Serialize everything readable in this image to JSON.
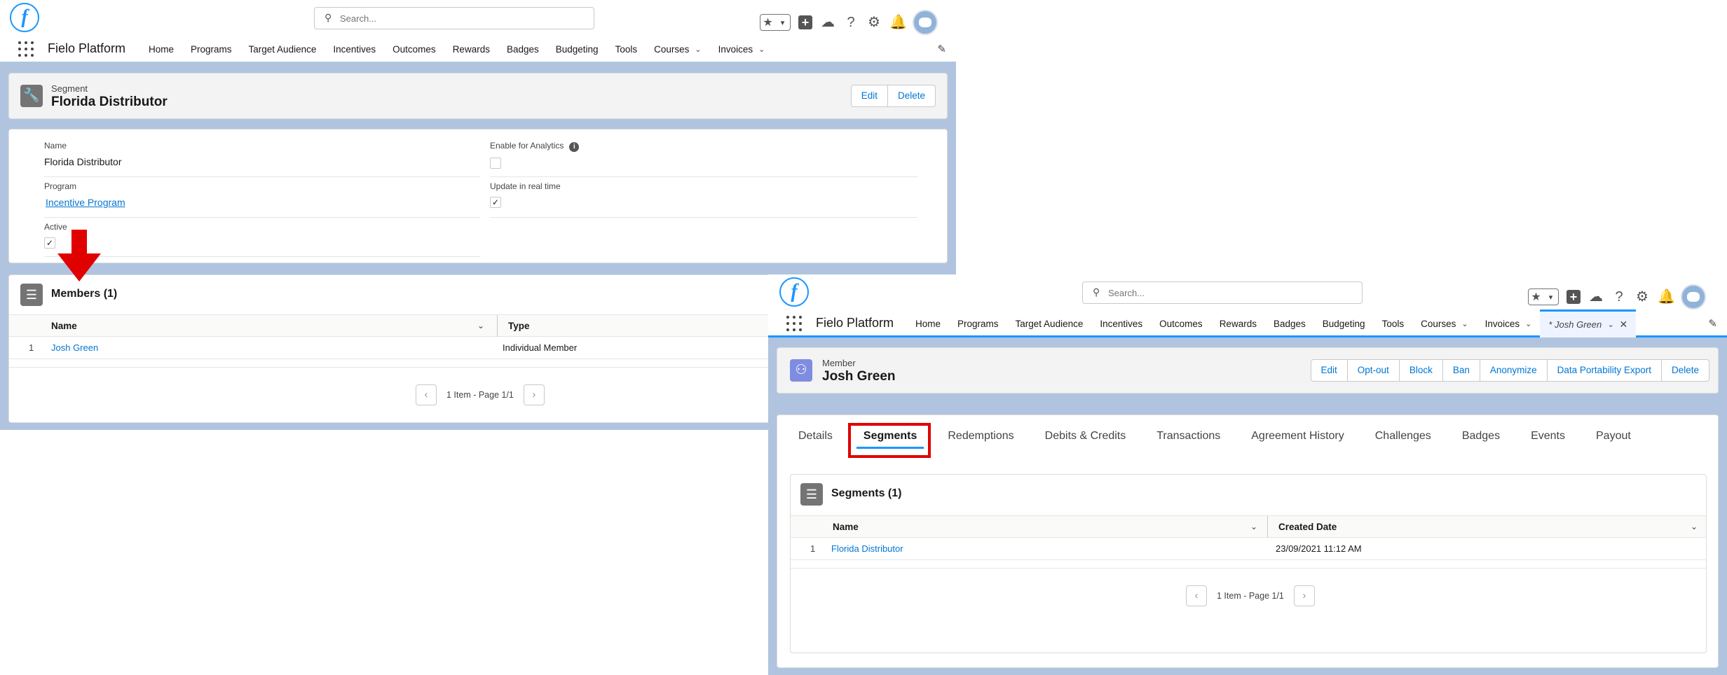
{
  "segment_screen": {
    "search_placeholder": "Search...",
    "app_name": "Fielo Platform",
    "nav": [
      "Home",
      "Programs",
      "Target Audience",
      "Incentives",
      "Outcomes",
      "Rewards",
      "Badges",
      "Budgeting",
      "Tools",
      "Courses",
      "Invoices"
    ],
    "record": {
      "object_label": "Segment",
      "title": "Florida Distributor",
      "buttons": [
        "Edit",
        "Delete"
      ]
    },
    "fields": {
      "name_label": "Name",
      "name_value": "Florida Distributor",
      "program_label": "Program",
      "program_value": "Incentive Program",
      "active_label": "Active",
      "active_checked": true,
      "analytics_label": "Enable for Analytics",
      "analytics_checked": false,
      "realtime_label": "Update in real time",
      "realtime_checked": true
    },
    "related_list": {
      "title": "Members (1)",
      "columns": [
        "Name",
        "Type"
      ],
      "rows": [
        {
          "num": "1",
          "name": "Josh Green",
          "type": "Individual Member"
        }
      ],
      "pager": "1 Item - Page 1/1"
    }
  },
  "member_screen": {
    "search_placeholder": "Search...",
    "app_name": "Fielo Platform",
    "nav": [
      "Home",
      "Programs",
      "Target Audience",
      "Incentives",
      "Outcomes",
      "Rewards",
      "Badges",
      "Budgeting",
      "Tools",
      "Courses",
      "Invoices"
    ],
    "open_tab": "* Josh Green",
    "record": {
      "object_label": "Member",
      "title": "Josh Green",
      "buttons": [
        "Edit",
        "Opt-out",
        "Block",
        "Ban",
        "Anonymize",
        "Data Portability Export",
        "Delete"
      ]
    },
    "tabs": [
      "Details",
      "Segments",
      "Redemptions",
      "Debits & Credits",
      "Transactions",
      "Agreement History",
      "Challenges",
      "Badges",
      "Events",
      "Payout"
    ],
    "active_tab": "Segments",
    "related_list": {
      "title": "Segments (1)",
      "columns": [
        "Name",
        "Created Date"
      ],
      "rows": [
        {
          "num": "1",
          "name": "Florida Distributor",
          "created": "23/09/2021 11:12 AM"
        }
      ],
      "pager": "1 Item - Page 1/1"
    }
  },
  "colors": {
    "accent": "#1b96ff",
    "highlight": "#e00000",
    "link": "#0176d3",
    "background": "#b0c4df"
  },
  "icons": [
    "fielo-logo",
    "search-icon",
    "star-icon",
    "plus-icon",
    "cloud-icon",
    "help-icon",
    "gear-icon",
    "bell-icon",
    "avatar",
    "waffle-icon",
    "pencil-icon",
    "wrench-icon",
    "members-icon",
    "list-icon",
    "chevron-down-icon",
    "chevron-left-icon",
    "chevron-right-icon",
    "info-icon",
    "close-icon",
    "down-arrow"
  ]
}
